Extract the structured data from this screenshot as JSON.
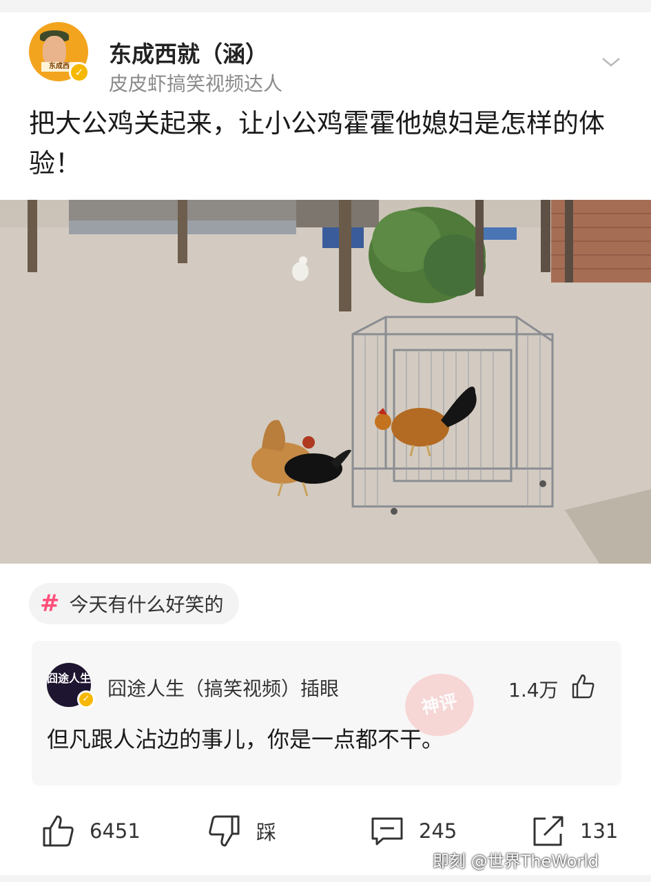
{
  "post": {
    "username": "东成西就（涵）",
    "user_tag": "皮皮虾搞笑视频达人",
    "title": "把大公鸡关起来，让小公鸡霍霍他媳妇是怎样的体验！",
    "avatar_tag": "东成西",
    "topic": "今天有什么好笑的"
  },
  "hot_comment": {
    "username": "囧途人生（搞笑视频）插眼",
    "avatar_text": "囧途人生",
    "likes": "1.4万",
    "text": "但凡跟人沾边的事儿，你是一点都不干。",
    "stamp": "神评"
  },
  "actions": {
    "like_count": "6451",
    "dislike_label": "踩",
    "comment_count": "245",
    "share_count": "131"
  },
  "watermark": "即刻 @世界TheWorld",
  "icons": [
    "chevron-down-icon",
    "verified-icon",
    "hashtag-icon",
    "thumbs-up-icon",
    "thumbs-down-icon",
    "comment-icon",
    "share-icon"
  ],
  "colors": {
    "topic_hash": "#ff4f7b",
    "verified": "#f6b800"
  }
}
